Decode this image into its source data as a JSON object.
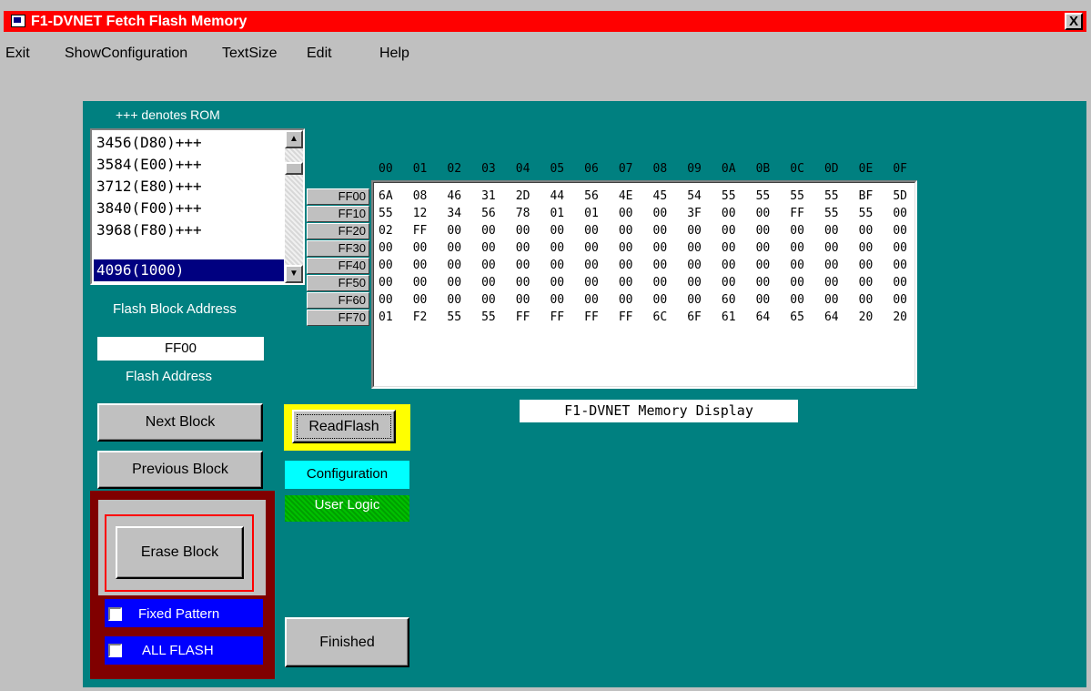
{
  "window": {
    "title": "F1-DVNET Fetch Flash Memory",
    "close_label": "X"
  },
  "menu": [
    "Exit",
    "ShowConfiguration",
    "TextSize",
    "Edit",
    "Help"
  ],
  "rom_note": "+++ denotes ROM",
  "block_list": {
    "items": [
      "3456(D80)+++",
      "3584(E00)+++",
      "3712(E80)+++",
      "3840(F00)+++",
      "3968(F80)+++",
      "4096(1000)"
    ],
    "selected": "4096(1000)"
  },
  "flash_block_address_label": "Flash Block Address",
  "flash_address_value": "FF00",
  "flash_address_label": "Flash Address",
  "hex": {
    "column_headers": [
      "00",
      "01",
      "02",
      "03",
      "04",
      "05",
      "06",
      "07",
      "08",
      "09",
      "0A",
      "0B",
      "0C",
      "0D",
      "0E",
      "0F"
    ],
    "row_labels": [
      "FF00",
      "FF10",
      "FF20",
      "FF30",
      "FF40",
      "FF50",
      "FF60",
      "FF70"
    ],
    "rows": [
      [
        "6A",
        "08",
        "46",
        "31",
        "2D",
        "44",
        "56",
        "4E",
        "45",
        "54",
        "55",
        "55",
        "55",
        "55",
        "BF",
        "5D"
      ],
      [
        "55",
        "12",
        "34",
        "56",
        "78",
        "01",
        "01",
        "00",
        "00",
        "3F",
        "00",
        "00",
        "FF",
        "55",
        "55",
        "00"
      ],
      [
        "02",
        "FF",
        "00",
        "00",
        "00",
        "00",
        "00",
        "00",
        "00",
        "00",
        "00",
        "00",
        "00",
        "00",
        "00",
        "00"
      ],
      [
        "00",
        "00",
        "00",
        "00",
        "00",
        "00",
        "00",
        "00",
        "00",
        "00",
        "00",
        "00",
        "00",
        "00",
        "00",
        "00"
      ],
      [
        "00",
        "00",
        "00",
        "00",
        "00",
        "00",
        "00",
        "00",
        "00",
        "00",
        "00",
        "00",
        "00",
        "00",
        "00",
        "00"
      ],
      [
        "00",
        "00",
        "00",
        "00",
        "00",
        "00",
        "00",
        "00",
        "00",
        "00",
        "00",
        "00",
        "00",
        "00",
        "00",
        "00"
      ],
      [
        "00",
        "00",
        "00",
        "00",
        "00",
        "00",
        "00",
        "00",
        "00",
        "00",
        "60",
        "00",
        "00",
        "00",
        "00",
        "00"
      ],
      [
        "01",
        "F2",
        "55",
        "55",
        "FF",
        "FF",
        "FF",
        "FF",
        "6C",
        "6F",
        "61",
        "64",
        "65",
        "64",
        "20",
        "20"
      ]
    ]
  },
  "memory_display_caption": "F1-DVNET Memory Display",
  "buttons": {
    "next_block": "Next Block",
    "previous_block": "Previous Block",
    "read_flash": "ReadFlash",
    "erase_block": "Erase Block",
    "finished": "Finished"
  },
  "status": {
    "configuration": "Configuration",
    "user_logic": "User Logic"
  },
  "checkboxes": {
    "fixed_pattern": "Fixed Pattern",
    "all_flash": "ALL FLASH"
  },
  "colors": {
    "panel": "#008080",
    "titlebar": "#ff0000",
    "selection": "#000080"
  }
}
